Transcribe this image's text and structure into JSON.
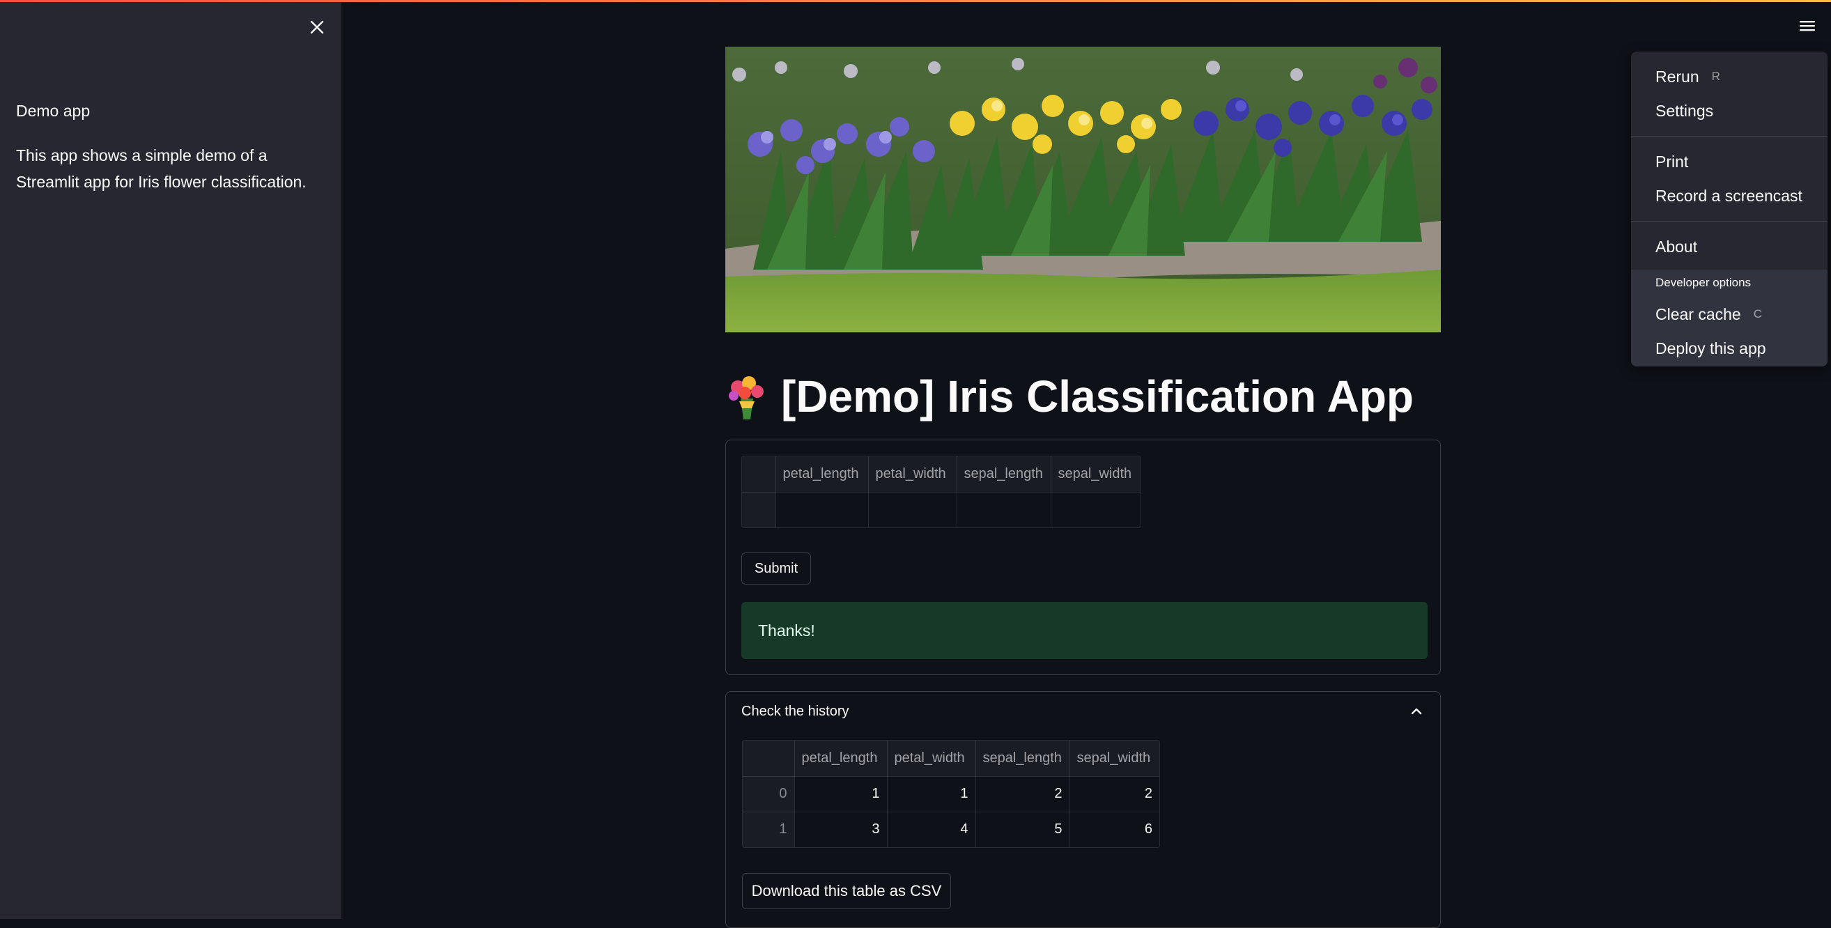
{
  "sidebar": {
    "title": "Demo app",
    "description": "This app shows a simple demo of a Streamlit app for Iris flower classification."
  },
  "main": {
    "hero_image": "iris flower garden photo",
    "title_icon": "bouquet-icon",
    "title": "[Demo] Iris Classification App",
    "form": {
      "columns": [
        "petal_length",
        "petal_width",
        "sepal_length",
        "sepal_width"
      ],
      "submit_label": "Submit",
      "success_message": "Thanks!"
    },
    "history": {
      "label": "Check the history",
      "columns": [
        "petal_length",
        "petal_width",
        "sepal_length",
        "sepal_width"
      ],
      "rows": [
        {
          "index": "0",
          "values": [
            "1",
            "1",
            "2",
            "2"
          ]
        },
        {
          "index": "1",
          "values": [
            "3",
            "4",
            "5",
            "6"
          ]
        }
      ],
      "download_label": "Download this table as CSV"
    }
  },
  "menu": {
    "items": [
      {
        "label": "Rerun",
        "shortcut": "R"
      },
      {
        "label": "Settings",
        "shortcut": ""
      },
      {
        "label": "Print",
        "shortcut": ""
      },
      {
        "label": "Record a screencast",
        "shortcut": ""
      },
      {
        "label": "About",
        "shortcut": ""
      }
    ],
    "developer_label": "Developer options",
    "developer_items": [
      {
        "label": "Clear cache",
        "shortcut": "C"
      },
      {
        "label": "Deploy this app",
        "shortcut": ""
      }
    ]
  },
  "colors": {
    "background": "#0e1117",
    "sidebar": "#262730",
    "success_bg": "#173928",
    "accent_start": "#ff4b4b",
    "accent_end": "#ffbd45"
  }
}
